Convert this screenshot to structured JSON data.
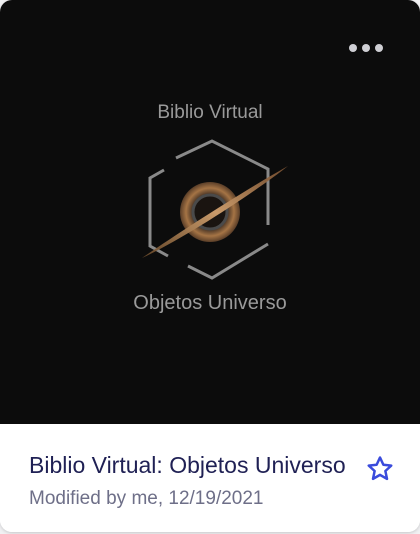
{
  "thumbnail": {
    "logo_top_text": "Biblio Virtual",
    "logo_bottom_text": "Objetos Universo"
  },
  "card": {
    "title": "Biblio Virtual: Objetos Universo",
    "subtitle": "Modified by me, 12/19/2021",
    "starred": false
  },
  "icons": {
    "more": "more-options-icon",
    "star": "star-outline-icon"
  },
  "colors": {
    "thumbnail_bg": "#0c0c0c",
    "title": "#1f2054",
    "subtitle": "#6e6f88",
    "star": "#3a4bdc",
    "logo_accent": "#b07a45"
  }
}
